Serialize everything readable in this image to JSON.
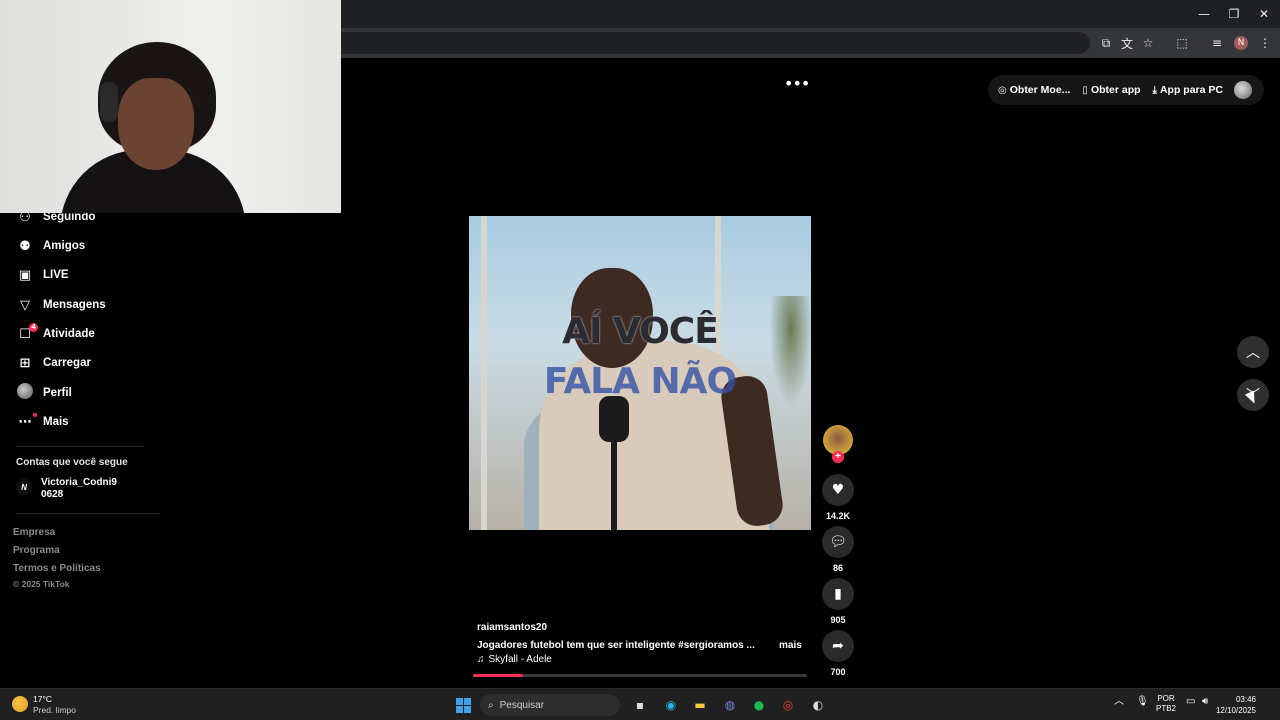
{
  "window": {
    "minimize_glyph": "—",
    "restore_glyph": "❐",
    "close_glyph": "✕"
  },
  "toolbar": {
    "profile_initial": "N"
  },
  "top_actions": {
    "items": [
      "Obter Moe...",
      "Obter app",
      "App para PC"
    ]
  },
  "sidebar": {
    "items": [
      {
        "label": "Seguindo",
        "icon": "people-follow-icon"
      },
      {
        "label": "Amigos",
        "icon": "friends-icon"
      },
      {
        "label": "LIVE",
        "icon": "live-icon"
      },
      {
        "label": "Mensagens",
        "icon": "messages-icon"
      },
      {
        "label": "Atividade",
        "icon": "activity-icon",
        "badge": "4"
      },
      {
        "label": "Carregar",
        "icon": "upload-icon"
      },
      {
        "label": "Perfil",
        "icon": "profile-avatar"
      },
      {
        "label": "Mais",
        "icon": "more-icon"
      }
    ],
    "following_title": "Contas que você segue",
    "following": [
      {
        "initial": "N",
        "name": "Victoria_Codni90628"
      }
    ],
    "footer": [
      "Empresa",
      "Programa",
      "Termos e Políticas"
    ],
    "copyright": "© 2025 TikTok"
  },
  "video": {
    "caption_line1": "AÍ VOCÊ",
    "caption_line2": "FALA NÃO",
    "author": "raiamsantos20",
    "description": "Jogadores futebol tem que ser inteligente #sergioramos ...",
    "more": "mais",
    "music": "Skyfall - Adele",
    "progress": 0.15
  },
  "actions": {
    "likes": "14.2K",
    "comments": "86",
    "saves": "905",
    "shares": "700"
  },
  "taskbar": {
    "temp": "17°C",
    "weather": "Pred. limpo",
    "search_placeholder": "Pesquisar",
    "lang1": "POR",
    "lang2": "PTB2",
    "time": "03:46",
    "date": "12/10/2025"
  },
  "colors": {
    "accent": "#fe2c55",
    "background": "#000000"
  }
}
